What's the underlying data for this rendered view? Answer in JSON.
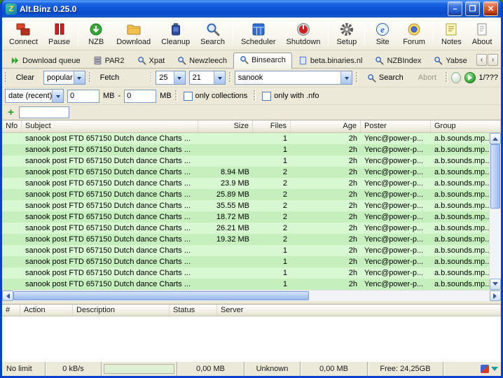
{
  "window": {
    "title": "Alt.Binz 0.25.0",
    "logo_letter": "Z",
    "controls": {
      "minimize": "–",
      "maximize": "❐",
      "close": "✕"
    }
  },
  "toolbar": {
    "items": [
      {
        "label": "Connect"
      },
      {
        "label": "Pause"
      },
      {
        "label": "NZB"
      },
      {
        "label": "Download"
      },
      {
        "label": "Cleanup"
      },
      {
        "label": "Search"
      },
      {
        "label": "Scheduler"
      },
      {
        "label": "Shutdown"
      },
      {
        "label": "Setup"
      },
      {
        "label": "Site"
      },
      {
        "label": "Forum"
      },
      {
        "label": "Notes"
      },
      {
        "label": "About"
      }
    ]
  },
  "tabs": {
    "items": [
      {
        "label": "Download queue"
      },
      {
        "label": "PAR2"
      },
      {
        "label": "Xpat"
      },
      {
        "label": "Newzleech"
      },
      {
        "label": "Binsearch"
      },
      {
        "label": "beta.binaries.nl"
      },
      {
        "label": "NZBIndex"
      },
      {
        "label": "Yabse"
      }
    ],
    "active": "Binsearch",
    "scroll_left_glyph": "‹",
    "scroll_right_glyph": "›"
  },
  "search_bar": {
    "clear": "Clear",
    "category": "popular",
    "fetch": "Fetch",
    "per_page": "25",
    "page_count": "21",
    "query": "sanook",
    "search": "Search",
    "abort": "Abort",
    "counter": "1/???"
  },
  "filter_bar": {
    "sort": "date (recent)",
    "min_size": "0",
    "min_unit": "MB",
    "dash": "-",
    "max_size": "0",
    "max_unit": "MB",
    "only_collections": "only collections",
    "only_with_nfo": "only with .nfo"
  },
  "add_row": {
    "plus_glyph": "+",
    "value": ""
  },
  "results": {
    "columns": [
      "Nfo",
      "Subject",
      "Size",
      "Files",
      "Age",
      "Poster",
      "Group"
    ],
    "rows": [
      {
        "nfo": "",
        "subject": "sanook post FTD 657150 Dutch dance Charts ...",
        "size": "",
        "files": "1",
        "age": "2h",
        "poster": "Yenc@power-p...",
        "group": "a.b.sounds.mp..."
      },
      {
        "nfo": "",
        "subject": "sanook post FTD 657150 Dutch dance Charts ...",
        "size": "",
        "files": "1",
        "age": "2h",
        "poster": "Yenc@power-p...",
        "group": "a.b.sounds.mp..."
      },
      {
        "nfo": "",
        "subject": "sanook post FTD 657150 Dutch dance Charts ...",
        "size": "",
        "files": "1",
        "age": "2h",
        "poster": "Yenc@power-p...",
        "group": "a.b.sounds.mp..."
      },
      {
        "nfo": "",
        "subject": "sanook post FTD 657150 Dutch dance Charts ...",
        "size": "8.94 MB",
        "files": "2",
        "age": "2h",
        "poster": "Yenc@power-p...",
        "group": "a.b.sounds.mp..."
      },
      {
        "nfo": "",
        "subject": "sanook post FTD 657150 Dutch dance Charts ...",
        "size": "23.9 MB",
        "files": "2",
        "age": "2h",
        "poster": "Yenc@power-p...",
        "group": "a.b.sounds.mp..."
      },
      {
        "nfo": "",
        "subject": "sanook post FTD 657150 Dutch dance Charts ...",
        "size": "25.89 MB",
        "files": "2",
        "age": "2h",
        "poster": "Yenc@power-p...",
        "group": "a.b.sounds.mp..."
      },
      {
        "nfo": "",
        "subject": "sanook post FTD 657150 Dutch dance Charts ...",
        "size": "35.55 MB",
        "files": "2",
        "age": "2h",
        "poster": "Yenc@power-p...",
        "group": "a.b.sounds.mp..."
      },
      {
        "nfo": "",
        "subject": "sanook post FTD 657150 Dutch dance Charts ...",
        "size": "18.72 MB",
        "files": "2",
        "age": "2h",
        "poster": "Yenc@power-p...",
        "group": "a.b.sounds.mp..."
      },
      {
        "nfo": "",
        "subject": "sanook post FTD 657150 Dutch dance Charts ...",
        "size": "26.21 MB",
        "files": "2",
        "age": "2h",
        "poster": "Yenc@power-p...",
        "group": "a.b.sounds.mp..."
      },
      {
        "nfo": "",
        "subject": "sanook post FTD 657150 Dutch dance Charts ...",
        "size": "19.32 MB",
        "files": "2",
        "age": "2h",
        "poster": "Yenc@power-p...",
        "group": "a.b.sounds.mp..."
      },
      {
        "nfo": "",
        "subject": "sanook post FTD 657150 Dutch dance Charts ...",
        "size": "",
        "files": "1",
        "age": "2h",
        "poster": "Yenc@power-p...",
        "group": "a.b.sounds.mp..."
      },
      {
        "nfo": "",
        "subject": "sanook post FTD 657150 Dutch dance Charts ...",
        "size": "",
        "files": "1",
        "age": "2h",
        "poster": "Yenc@power-p...",
        "group": "a.b.sounds.mp..."
      },
      {
        "nfo": "",
        "subject": "sanook post FTD 657150 Dutch dance Charts ...",
        "size": "",
        "files": "1",
        "age": "2h",
        "poster": "Yenc@power-p...",
        "group": "a.b.sounds.mp..."
      },
      {
        "nfo": "",
        "subject": "sanook post FTD 657150 Dutch dance Charts ...",
        "size": "",
        "files": "1",
        "age": "2h",
        "poster": "Yenc@power-p...",
        "group": "a.b.sounds.mp..."
      }
    ]
  },
  "queue": {
    "columns": [
      "#",
      "Action",
      "Description",
      "Status",
      "Server"
    ]
  },
  "status_bar": {
    "speed_limit": "No limit",
    "speed": "0 kB/s",
    "downloaded": "0,00 MB",
    "eta": "Unknown",
    "session": "0,00 MB",
    "free_space": "Free: 24,25GB"
  }
}
